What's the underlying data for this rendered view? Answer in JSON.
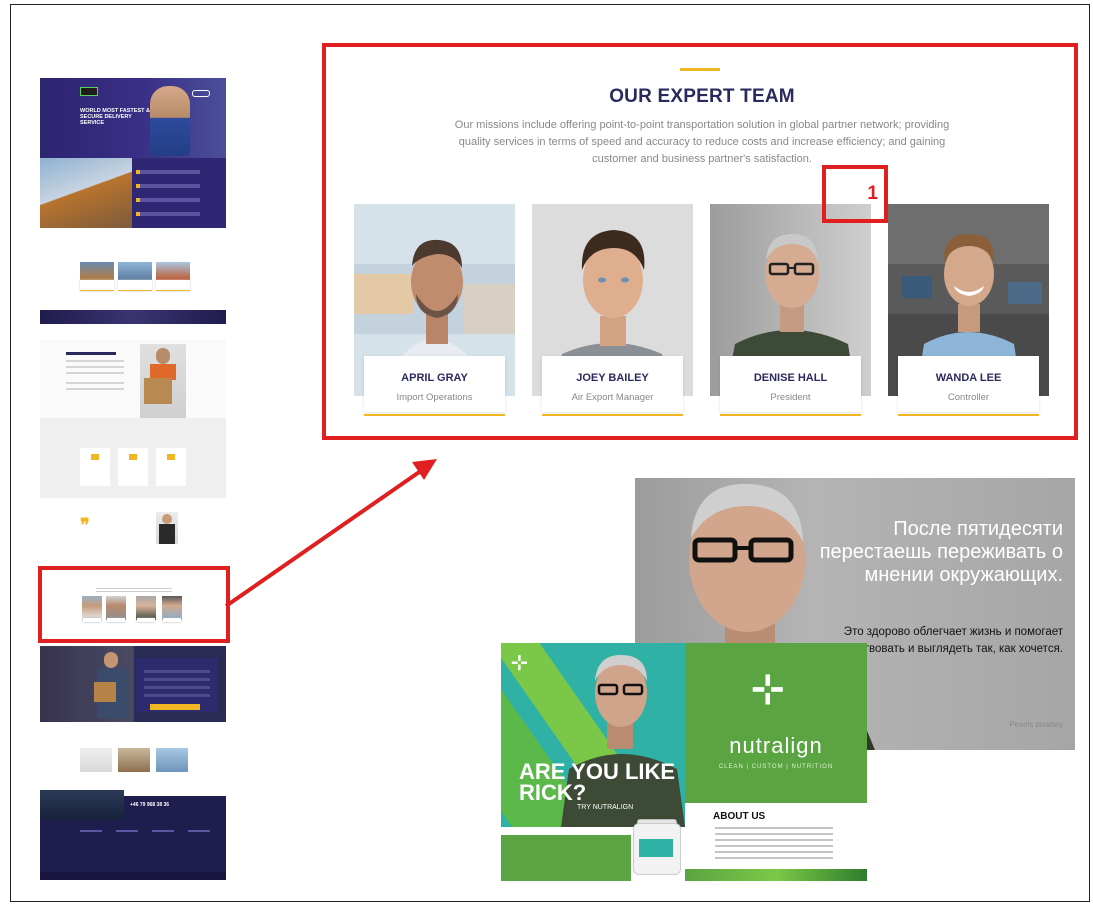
{
  "team": {
    "title": "OUR EXPERT TEAM",
    "description": "Our missions include offering point-to-point transportation solution in global partner network; providing quality services in terms of speed and accuracy to reduce costs and increase efficiency; and gaining customer and business partner's satisfaction.",
    "members": [
      {
        "name": "APRIL GRAY",
        "role": "Import Operations"
      },
      {
        "name": "JOEY BAILEY",
        "role": "Air Export Manager"
      },
      {
        "name": "DENISE HALL",
        "role": "President"
      },
      {
        "name": "WANDA LEE",
        "role": "Controller"
      }
    ]
  },
  "annotation": {
    "number": "1"
  },
  "thumbnail": {
    "hero_title": "WORLD MOST FASTEST & SECURE DELIVERY SERVICE",
    "phone": "+46 79 968 38 36"
  },
  "ad_russian": {
    "headline": "После пятидесяти перестаешь переживать о мнении окружающих.",
    "body": "Это здорово облегчает жизнь и помогает действовать и выглядеть так, как хочется.",
    "credit": "Pexels pixabay"
  },
  "ad_nutralign": {
    "slogan": "ARE YOU LIKE RICK?",
    "cta": "TRY NUTRALIGN",
    "brand": "nutralign",
    "tagline": "CLEAN | CUSTOM | NUTRITION",
    "about_title": "ABOUT US"
  },
  "colors": {
    "accent": "#f1b722",
    "heading": "#2b2a5c",
    "highlight": "#e02020",
    "brand_purple": "#2f2773"
  }
}
